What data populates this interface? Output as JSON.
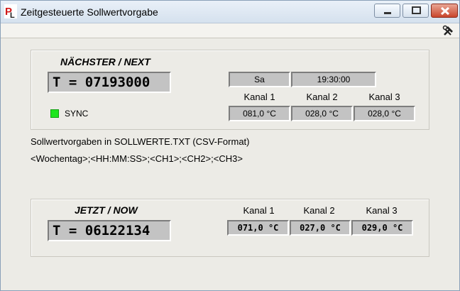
{
  "window": {
    "title": "Zeitgesteuerte Sollwertvorgabe",
    "buttons": {
      "minimize_icon": "minimize-icon",
      "maximize_icon": "maximize-icon",
      "close_icon": "close-icon"
    },
    "toolbar_icon": "tools-icon"
  },
  "next": {
    "heading": "NÄCHSTER / NEXT",
    "t_value": "T = 07193000",
    "day": "Sa",
    "time": "19:30:00",
    "channels": [
      {
        "label": "Kanal 1",
        "value": "081,0 °C"
      },
      {
        "label": "Kanal 2",
        "value": "028,0 °C"
      },
      {
        "label": "Kanal 3",
        "value": "028,0 °C"
      }
    ],
    "sync_label": "SYNC",
    "sync_color": "#1ee61e"
  },
  "info": {
    "line1": "Sollwertvorgaben in SOLLWERTE.TXT (CSV-Format)",
    "line2": "<Wochentag>;<HH:MM:SS>;<CH1>;<CH2>;<CH3>"
  },
  "now": {
    "heading": "JETZT / NOW",
    "t_value": "T = 06122134",
    "channels": [
      {
        "label": "Kanal 1",
        "value": "071,0 °C"
      },
      {
        "label": "Kanal 2",
        "value": "027,0 °C"
      },
      {
        "label": "Kanal 3",
        "value": "029,0 °C"
      }
    ]
  }
}
